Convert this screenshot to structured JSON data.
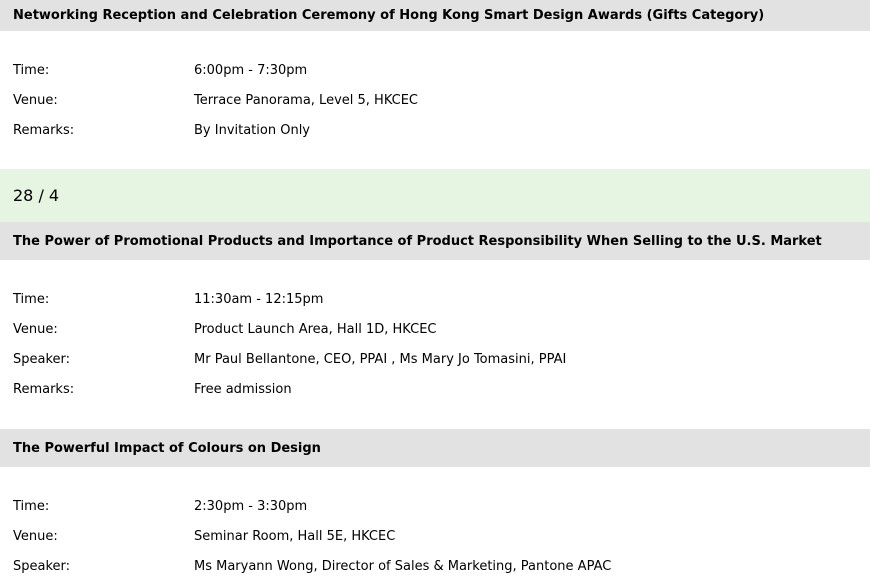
{
  "events_top": {
    "title": "Networking Reception and Celebration Ceremony of Hong Kong Smart Design Awards (Gifts Category)",
    "rows": [
      {
        "label": "Time:",
        "value": "6:00pm - 7:30pm"
      },
      {
        "label": "Venue:",
        "value": "Terrace Panorama, Level 5, HKCEC"
      },
      {
        "label": "Remarks:",
        "value": "By Invitation Only"
      }
    ]
  },
  "date_header": "28 / 4",
  "event_promo": {
    "title": "The Power of Promotional Products and Importance of Product Responsibility When Selling to the U.S. Market",
    "rows": [
      {
        "label": "Time:",
        "value": "11:30am - 12:15pm"
      },
      {
        "label": "Venue:",
        "value": "Product Launch Area, Hall 1D, HKCEC"
      },
      {
        "label": "Speaker:",
        "value": "Mr Paul Bellantone, CEO, PPAI , Ms Mary Jo Tomasini, PPAI"
      },
      {
        "label": "Remarks:",
        "value": "Free admission"
      }
    ]
  },
  "event_colours": {
    "title": "The Powerful Impact of Colours on Design",
    "rows": [
      {
        "label": "Time:",
        "value": "2:30pm - 3:30pm"
      },
      {
        "label": "Venue:",
        "value": "Seminar Room, Hall 5E, HKCEC"
      },
      {
        "label": "Speaker:",
        "value": "Ms Maryann Wong, Director of Sales & Marketing, Pantone APAC"
      }
    ]
  }
}
